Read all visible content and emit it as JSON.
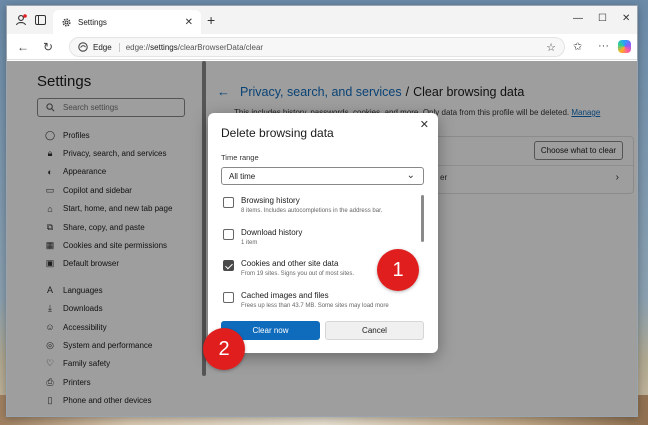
{
  "tab": {
    "title": "Settings"
  },
  "address_bar": {
    "label": "Edge",
    "url_prefix": "edge://",
    "url_bold": "settings",
    "url_rest": "/clearBrowserData/clear"
  },
  "sidebar": {
    "title": "Settings",
    "search_placeholder": "Search settings",
    "items": [
      {
        "label": "Profiles",
        "icon": "profile-icon"
      },
      {
        "label": "Privacy, search, and services",
        "icon": "lock-icon"
      },
      {
        "label": "Appearance",
        "icon": "appearance-icon"
      },
      {
        "label": "Copilot and sidebar",
        "icon": "sidebar-icon"
      },
      {
        "label": "Start, home, and new tab page",
        "icon": "home-icon"
      },
      {
        "label": "Share, copy, and paste",
        "icon": "share-icon"
      },
      {
        "label": "Cookies and site permissions",
        "icon": "cookie-icon"
      },
      {
        "label": "Default browser",
        "icon": "browser-icon"
      },
      {
        "label": "Languages",
        "icon": "languages-icon"
      },
      {
        "label": "Downloads",
        "icon": "download-icon"
      },
      {
        "label": "Accessibility",
        "icon": "accessibility-icon"
      },
      {
        "label": "System and performance",
        "icon": "system-icon"
      },
      {
        "label": "Family safety",
        "icon": "family-icon"
      },
      {
        "label": "Printers",
        "icon": "printer-icon"
      },
      {
        "label": "Phone and other devices",
        "icon": "phone-icon"
      }
    ]
  },
  "main": {
    "breadcrumb_link": "Privacy, search, and services",
    "breadcrumb_sep": "/",
    "breadcrumb_current": "Clear browsing data",
    "description": "This includes history, passwords, cookies, and more. Only data from this profile will be deleted.",
    "manage_link": "Manage",
    "choose_button": "Choose what to clear",
    "row_fragment": "er"
  },
  "dialog": {
    "title": "Delete browsing data",
    "time_range_label": "Time range",
    "time_range_value": "All time",
    "options": [
      {
        "title": "Browsing history",
        "subtitle": "8 items. Includes autocompletions in the address bar.",
        "checked": false
      },
      {
        "title": "Download history",
        "subtitle": "1 item",
        "checked": false
      },
      {
        "title": "Cookies and other site data",
        "subtitle": "From 19 sites. Signs you out of most sites.",
        "checked": true
      },
      {
        "title": "Cached images and files",
        "subtitle": "Frees up less than 43.7 MB. Some sites may load more",
        "checked": false
      }
    ],
    "clear_button": "Clear now",
    "cancel_button": "Cancel"
  },
  "markers": {
    "one": "1",
    "two": "2"
  },
  "colors": {
    "accent": "#0f6cbd",
    "marker": "#e01e1e"
  }
}
